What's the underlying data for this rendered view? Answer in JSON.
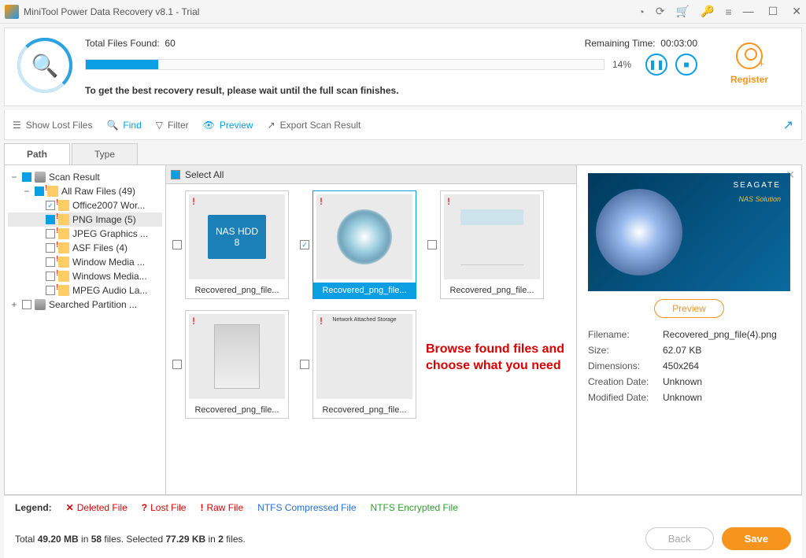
{
  "titlebar": {
    "title": "MiniTool Power Data Recovery v8.1 - Trial"
  },
  "progress": {
    "found_label": "Total Files Found:",
    "found_value": "60",
    "remaining_label": "Remaining Time:",
    "remaining_value": "00:03:00",
    "percent": "14%",
    "note": "To get the best recovery result, please wait until the full scan finishes.",
    "register": "Register"
  },
  "toolbar": {
    "show_lost": "Show Lost Files",
    "find": "Find",
    "filter": "Filter",
    "preview": "Preview",
    "export": "Export Scan Result"
  },
  "tabs": {
    "path": "Path",
    "type": "Type"
  },
  "tree": {
    "root": "Scan Result",
    "raw": "All Raw Files (49)",
    "items": [
      "Office2007 Wor...",
      "PNG Image (5)",
      "JPEG Graphics ...",
      "ASF Files (4)",
      "Window Media ...",
      "Windows Media...",
      "MPEG Audio La..."
    ],
    "searched": "Searched Partition ..."
  },
  "grid": {
    "select_all": "Select All",
    "thumbs": [
      "Recovered_png_file...",
      "Recovered_png_file...",
      "Recovered_png_file...",
      "Recovered_png_file...",
      "Recovered_png_file..."
    ],
    "callout": "Browse found files and choose what you need"
  },
  "preview": {
    "brand": "SEAGATE",
    "sub": "NAS Solution",
    "button": "Preview",
    "meta": {
      "filename_k": "Filename:",
      "filename_v": "Recovered_png_file(4).png",
      "size_k": "Size:",
      "size_v": "62.07 KB",
      "dim_k": "Dimensions:",
      "dim_v": "450x264",
      "created_k": "Creation Date:",
      "created_v": "Unknown",
      "modified_k": "Modified Date:",
      "modified_v": "Unknown"
    }
  },
  "legend": {
    "label": "Legend:",
    "deleted": "Deleted File",
    "lost": "Lost File",
    "raw": "Raw File",
    "ntfs_c": "NTFS Compressed File",
    "ntfs_e": "NTFS Encrypted File"
  },
  "status": {
    "text_a": "Total ",
    "total_size": "49.20 MB",
    "text_b": " in ",
    "total_files": "58",
    "text_c": " files.   Selected ",
    "sel_size": "77.29 KB",
    "text_d": " in ",
    "sel_files": "2",
    "text_e": " files.",
    "back": "Back",
    "save": "Save"
  }
}
